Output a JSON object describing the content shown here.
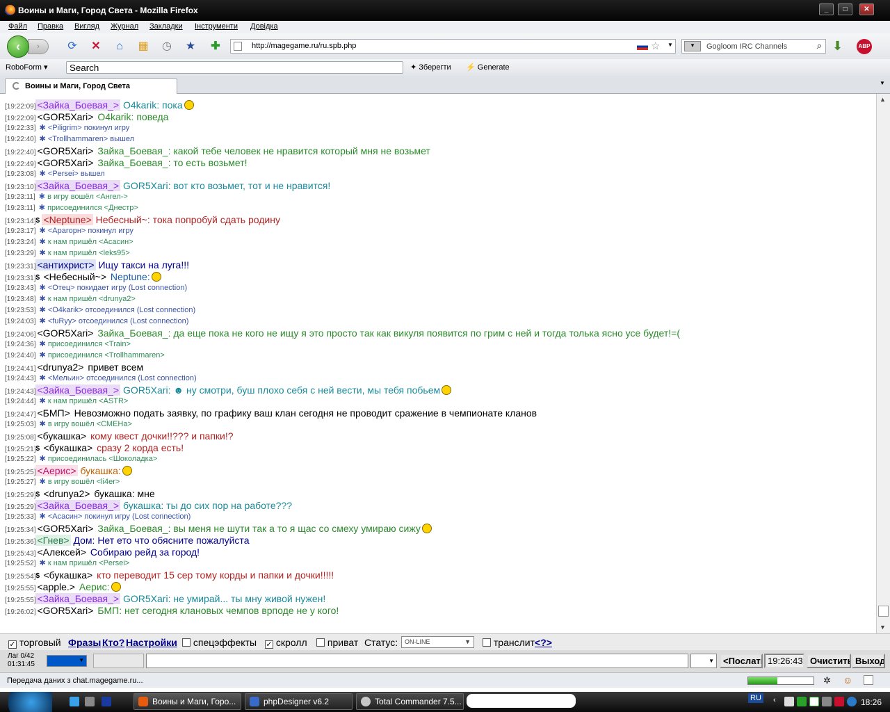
{
  "window": {
    "title": "Воины и Маги, Город Света - Mozilla Firefox"
  },
  "menu": [
    "Файл",
    "Правка",
    "Вигляд",
    "Журнал",
    "Закладки",
    "Інструменти",
    "Довідка"
  ],
  "nav": {
    "url": "http://magegame.ru/ru.spb.php",
    "search_engine": "Gogloom IRC Channels"
  },
  "robo": {
    "label": "RoboForm",
    "search_placeholder": "Search",
    "save": "Зберегти",
    "generate": "Generate"
  },
  "tab": {
    "label": "Воины и Маги, Город Света"
  },
  "colors": {
    "green": "#2c8a2c",
    "teal": "#1a7a9a",
    "purple": "#8a2be2",
    "red": "#b22222",
    "sysblue": "#3a53a8",
    "sysgreen": "#2e8b57"
  },
  "chat_lines": [
    {
      "ts": "[19:22:09]",
      "kind": "msg",
      "dollar": false,
      "nick": "<Зайка_Боевая_>",
      "nick_bg": "#eadcf7",
      "nick_color": "#8a2be2",
      "text": "O4karik: пока",
      "text_color": "#1a8a9a",
      "smile": true,
      "size": 14
    },
    {
      "ts": "[19:22:09]",
      "kind": "msg",
      "dollar": false,
      "nick": "<GOR5Xari>",
      "nick_bg": "",
      "nick_color": "#000",
      "text": "O4karik: поведа",
      "text_color": "#2c8a2c",
      "smile": false,
      "size": 14
    },
    {
      "ts": "[19:22:33]",
      "kind": "sys",
      "text": "<Piligrim> покинул игру",
      "color": "#3a53a8"
    },
    {
      "ts": "[19:22:40]",
      "kind": "sys",
      "text": "<Trollhammaren> вышел",
      "color": "#3a53a8"
    },
    {
      "ts": "[19:22:40]",
      "kind": "msg",
      "dollar": false,
      "nick": "<GOR5Xari>",
      "nick_bg": "",
      "nick_color": "#000",
      "text": "Зайка_Боевая_: какой тебе человек не нравится который мня не возьмет",
      "text_color": "#2c8a2c",
      "smile": false,
      "size": 14
    },
    {
      "ts": "[19:22:49]",
      "kind": "msg",
      "dollar": false,
      "nick": "<GOR5Xari>",
      "nick_bg": "",
      "nick_color": "#000",
      "text": "Зайка_Боевая_: то есть возьмет!",
      "text_color": "#2c8a2c",
      "smile": false,
      "size": 14
    },
    {
      "ts": "[19:23:08]",
      "kind": "sys",
      "text": "<Persei> вышел",
      "color": "#3a53a8"
    },
    {
      "ts": "[19:23:10]",
      "kind": "msg",
      "dollar": false,
      "nick": "<Зайка_Боевая_>",
      "nick_bg": "#eadcf7",
      "nick_color": "#8a2be2",
      "text": "GOR5Xari: вот кто возьмет, тот и не нравится!",
      "text_color": "#1a8a9a",
      "smile": false,
      "size": 14
    },
    {
      "ts": "[19:23:11]",
      "kind": "sys",
      "text": "в игру вошёл <Ангел->",
      "color": "#2e8b57"
    },
    {
      "ts": "[19:23:11]",
      "kind": "sys",
      "text": "присоединился <Днестр>",
      "color": "#2e8b57"
    },
    {
      "ts": "[19:23:14]",
      "kind": "msg",
      "dollar": true,
      "nick": "<Neptune>",
      "nick_bg": "#fbdcdc",
      "nick_color": "#b22222",
      "text": "Небесный~: тока попробуй сдать родину",
      "text_color": "#b22222",
      "smile": false,
      "size": 14
    },
    {
      "ts": "[19:23:17]",
      "kind": "sys",
      "text": "<Арагорн> покинул игру",
      "color": "#3a53a8"
    },
    {
      "ts": "[19:23:24]",
      "kind": "sys",
      "text": "к нам пришёл <Асасин>",
      "color": "#2e8b57"
    },
    {
      "ts": "[19:23:29]",
      "kind": "sys",
      "text": "к нам пришёл <leks95>",
      "color": "#2e8b57"
    },
    {
      "ts": "[19:23:31]",
      "kind": "msg",
      "dollar": false,
      "nick": "<антихрист>",
      "nick_bg": "#dde4f5",
      "nick_color": "#00008b",
      "text": "Ищу такси на луга!!!",
      "text_color": "#00008b",
      "smile": false,
      "size": 14
    },
    {
      "ts": "[19:23:31]",
      "kind": "msg",
      "dollar": true,
      "nick": "<Небесный~>",
      "nick_bg": "",
      "nick_color": "#000",
      "text": "Neptune:",
      "text_color": "#1a5aa0",
      "smile": true,
      "size": 14
    },
    {
      "ts": "[19:23:43]",
      "kind": "sys",
      "text": "<Отец> покидает игру (Lost connection)",
      "color": "#3a53a8"
    },
    {
      "ts": "[19:23:48]",
      "kind": "sys",
      "text": "к нам пришёл <drunya2>",
      "color": "#2e8b57"
    },
    {
      "ts": "[19:23:53]",
      "kind": "sys",
      "text": "<O4karik> отсоединился (Lost connection)",
      "color": "#3a53a8"
    },
    {
      "ts": "[19:24:03]",
      "kind": "sys",
      "text": "<fuRyy> отсоединился (Lost connection)",
      "color": "#3a53a8"
    },
    {
      "ts": "[19:24:06]",
      "kind": "msg",
      "dollar": false,
      "nick": "<GOR5Xari>",
      "nick_bg": "",
      "nick_color": "#000",
      "text": "Зайка_Боевая_: да еще пока не кого не ищу я это просто так как викуля появится по грим с ней и тогда толька ясно усе будет!=(",
      "text_color": "#2c8a2c",
      "smile": false,
      "size": 14
    },
    {
      "ts": "[19:24:36]",
      "kind": "sys",
      "text": "присоединился <Train>",
      "color": "#2e8b57"
    },
    {
      "ts": "[19:24:40]",
      "kind": "sys",
      "text": "присоединился <Trollhammaren>",
      "color": "#2e8b57"
    },
    {
      "ts": "[19:24:41]",
      "kind": "msg",
      "dollar": false,
      "nick": "<drunya2>",
      "nick_bg": "",
      "nick_color": "#000",
      "text": "привет всем",
      "text_color": "#000",
      "smile": false,
      "size": 14
    },
    {
      "ts": "[19:24:43]",
      "kind": "sys",
      "text": "<Мельин> отсоединился (Lost connection)",
      "color": "#3a53a8"
    },
    {
      "ts": "[19:24:43]",
      "kind": "msg",
      "dollar": false,
      "nick": "<Зайка_Боевая_>",
      "nick_bg": "#eadcf7",
      "nick_color": "#8a2be2",
      "text": "GOR5Xari: ☻ ну смотри, буш плохо себя с ней вести, мы тебя побьем",
      "text_color": "#1a8a9a",
      "smile": true,
      "size": 14
    },
    {
      "ts": "[19:24:44]",
      "kind": "sys",
      "text": "к нам пришёл <ASTR>",
      "color": "#2e8b57"
    },
    {
      "ts": "[19:24:47]",
      "kind": "msg",
      "dollar": false,
      "nick": "<БМП>",
      "nick_bg": "",
      "nick_color": "#000",
      "text": "Невозможно подать заявку, по графику ваш клан сегодня не проводит сражение в чемпионате кланов",
      "text_color": "#000",
      "smile": false,
      "size": 14
    },
    {
      "ts": "[19:25:03]",
      "kind": "sys",
      "text": "в игру вошёл <СМЕНа>",
      "color": "#2e8b57"
    },
    {
      "ts": "[19:25:08]",
      "kind": "msg",
      "dollar": false,
      "nick": "<букашка>",
      "nick_bg": "",
      "nick_color": "#000",
      "text": "кому квест дочки!!??? и папки!?",
      "text_color": "#b22222",
      "smile": false,
      "size": 14
    },
    {
      "ts": "[19:25:21]",
      "kind": "msg",
      "dollar": true,
      "nick": "<букашка>",
      "nick_bg": "",
      "nick_color": "#000",
      "text": "сразу 2 корда есть!",
      "text_color": "#b22222",
      "smile": false,
      "size": 14
    },
    {
      "ts": "[19:25:22]",
      "kind": "sys",
      "text": "присоединилась <Шоколадка>",
      "color": "#2e8b57"
    },
    {
      "ts": "[19:25:25]",
      "kind": "msg",
      "dollar": false,
      "nick": "<Аерис>",
      "nick_bg": "#fbe0ea",
      "nick_color": "#c0106a",
      "text": "букашка:",
      "text_color": "#c06000",
      "smile": true,
      "size": 14
    },
    {
      "ts": "[19:25:27]",
      "kind": "sys",
      "text": "в игру вошёл <li4er>",
      "color": "#2e8b57"
    },
    {
      "ts": "[19:25:29]",
      "kind": "msg",
      "dollar": true,
      "nick": "<drunya2>",
      "nick_bg": "",
      "nick_color": "#000",
      "text": "букашка: мне",
      "text_color": "#000",
      "smile": false,
      "size": 14
    },
    {
      "ts": "[19:25:29]",
      "kind": "msg",
      "dollar": false,
      "nick": "<Зайка_Боевая_>",
      "nick_bg": "#eadcf7",
      "nick_color": "#8a2be2",
      "text": "букашка: ты до сих пор на работе???",
      "text_color": "#1a8a9a",
      "smile": false,
      "size": 14
    },
    {
      "ts": "[19:25:33]",
      "kind": "sys",
      "text": "<Асасин> покинул игру (Lost connection)",
      "color": "#3a53a8"
    },
    {
      "ts": "[19:25:34]",
      "kind": "msg",
      "dollar": false,
      "nick": "<GOR5Xari>",
      "nick_bg": "",
      "nick_color": "#000",
      "text": "Зайка_Боевая_: вы меня не шути так а то я щас со смеху умираю сижу",
      "text_color": "#2c8a2c",
      "smile": true,
      "size": 14
    },
    {
      "ts": "[19:25:36]",
      "kind": "msg",
      "dollar": false,
      "nick": "<Гнев>",
      "nick_bg": "#dff2e6",
      "nick_color": "#2a7a50",
      "text": "Дом: Нет ето что обясните пожалуйста",
      "text_color": "#00008b",
      "smile": false,
      "size": 14
    },
    {
      "ts": "[19:25:43]",
      "kind": "msg",
      "dollar": false,
      "nick": "<Алексей>",
      "nick_bg": "",
      "nick_color": "#000",
      "text": "Собираю рейд за город!",
      "text_color": "#00008b",
      "smile": false,
      "size": 14
    },
    {
      "ts": "[19:25:52]",
      "kind": "sys",
      "text": "к нам пришёл <Persei>",
      "color": "#2e8b57"
    },
    {
      "ts": "[19:25:54]",
      "kind": "msg",
      "dollar": true,
      "nick": "<букашка>",
      "nick_bg": "",
      "nick_color": "#000",
      "text": "кто переводит 15 сер тому корды и папки и дочки!!!!!",
      "text_color": "#b22222",
      "smile": false,
      "size": 14
    },
    {
      "ts": "[19:25:55]",
      "kind": "msg",
      "dollar": false,
      "nick": "<apple.>",
      "nick_bg": "",
      "nick_color": "#000",
      "text": "Аерис:",
      "text_color": "#2c8a2c",
      "smile": true,
      "size": 14
    },
    {
      "ts": "[19:25:55]",
      "kind": "msg",
      "dollar": false,
      "nick": "<Зайка_Боевая_>",
      "nick_bg": "#eadcf7",
      "nick_color": "#8a2be2",
      "text": "GOR5Xari: не умирай... ты мну живой нужен!",
      "text_color": "#1a8a9a",
      "smile": false,
      "size": 14
    },
    {
      "ts": "[19:26:02]",
      "kind": "msg",
      "dollar": false,
      "nick": "<GOR5Xari>",
      "nick_bg": "",
      "nick_color": "#000",
      "text": "БМП: нет сегодня клановых чемпов врподе не у кого!",
      "text_color": "#2c8a2c",
      "smile": false,
      "size": 14
    }
  ],
  "controls": {
    "trade": "торговый",
    "phrases": "Фразы",
    "who": "Кто?",
    "settings": "Настройки",
    "effects": "спецэффекты",
    "scroll": "скролл",
    "private": "приват",
    "status_label": "Статус:",
    "status_value": "ON-LINE",
    "translit": "транслит",
    "help": "<?>"
  },
  "input": {
    "lag": "Лаг 0/42",
    "timer": "01:31:45",
    "send": "<Послать",
    "time": "19:26:43",
    "clear": "Очистить",
    "exit": "Выход"
  },
  "status": {
    "text": "Передача даних з chat.magegame.ru...",
    "progress": 0.45
  },
  "taskbar": {
    "tasks": [
      "Воины и Маги, Горо...",
      "phpDesigner v6.2",
      "Total Commander 7.5..."
    ],
    "lang": "RU",
    "clock": "18:26"
  }
}
